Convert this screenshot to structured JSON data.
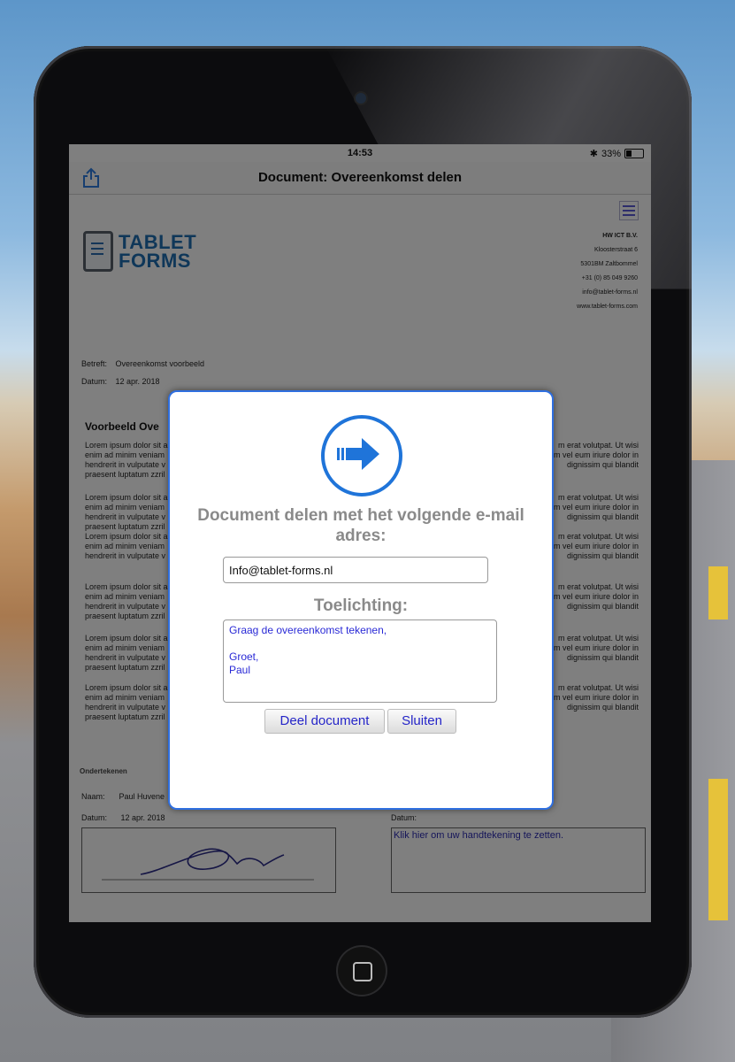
{
  "status": {
    "time": "14:53",
    "battery": "33%"
  },
  "nav": {
    "title": "Document: Overeenkomst delen"
  },
  "company": {
    "name": "HW ICT B.V.",
    "lines": [
      "Kloosterstraat 6",
      "5301BM Zaltbommel",
      "+31 (0) 85 049 9260",
      "info@tablet-forms.nl",
      "www.tablet-forms.com"
    ]
  },
  "logo": {
    "line1": "TABLET",
    "line2": "FORMS"
  },
  "doc": {
    "betreft_label": "Betreft:",
    "betreft_value": "Overeenkomst voorbeeld",
    "datum_label": "Datum:",
    "datum_value": "12 apr. 2018",
    "heading": "Voorbeeld Ove",
    "paragraphs": [
      {
        "left": "Lorem ipsum dolor sit a\nenim ad minim veniam\nhendrerit in vulputate v\npraesent luptatum zzril",
        "right": "m erat volutpat. Ut wisi\nm vel eum iriure dolor in\ndignissim qui blandit"
      },
      {
        "left": "Lorem ipsum dolor sit a\nenim ad minim veniam\nhendrerit in vulputate v\npraesent luptatum zzril",
        "right": "m erat volutpat. Ut wisi\nm vel eum iriure dolor in\ndignissim qui blandit"
      },
      {
        "left": "Lorem ipsum dolor sit a\nenim ad minim veniam\nhendrerit in vulputate v",
        "right": "m erat volutpat. Ut wisi\nm vel eum iriure dolor in\ndignissim qui blandit"
      },
      {
        "left": "Lorem ipsum dolor sit a\nenim ad minim veniam\nhendrerit in vulputate v\npraesent luptatum zzril",
        "right": "m erat volutpat. Ut wisi\nm vel eum iriure dolor in\ndignissim qui blandit"
      },
      {
        "left": "Lorem ipsum dolor sit a\nenim ad minim veniam\nhendrerit in vulputate v\npraesent luptatum zzril",
        "right": "m erat volutpat. Ut wisi\nm vel eum iriure dolor in\ndignissim qui blandit"
      },
      {
        "left": "Lorem ipsum dolor sit a\nenim ad minim veniam\nhendrerit in vulputate v\npraesent luptatum zzril",
        "right": "m erat volutpat. Ut wisi\nm vel eum iriure dolor in\ndignissim qui blandit"
      }
    ],
    "ondertekenen": "Ondertekenen",
    "naam_label": "Naam:",
    "naam_value": "Paul Huvene",
    "datum2_label": "Datum:",
    "datum2_value": "12 apr. 2018",
    "datum3_label": "Datum:",
    "sign_prompt": "Klik hier om uw handtekening te zetten."
  },
  "modal": {
    "title": "Document delen met het volgende e-mail adres:",
    "email": "Info@tablet-forms.nl",
    "toelichting_label": "Toelichting:",
    "toelichting": "Graag de overeenkomst tekenen,\n\nGroet,\nPaul",
    "share_button": "Deel document",
    "close_button": "Sluiten"
  },
  "colors": {
    "accent": "#1f74d9",
    "link": "#2525c8",
    "label_gray": "#8a8a8a"
  },
  "icons": {
    "share": "share-icon",
    "menu": "hamburger-menu-icon",
    "arrow": "arrow-right-icon"
  }
}
